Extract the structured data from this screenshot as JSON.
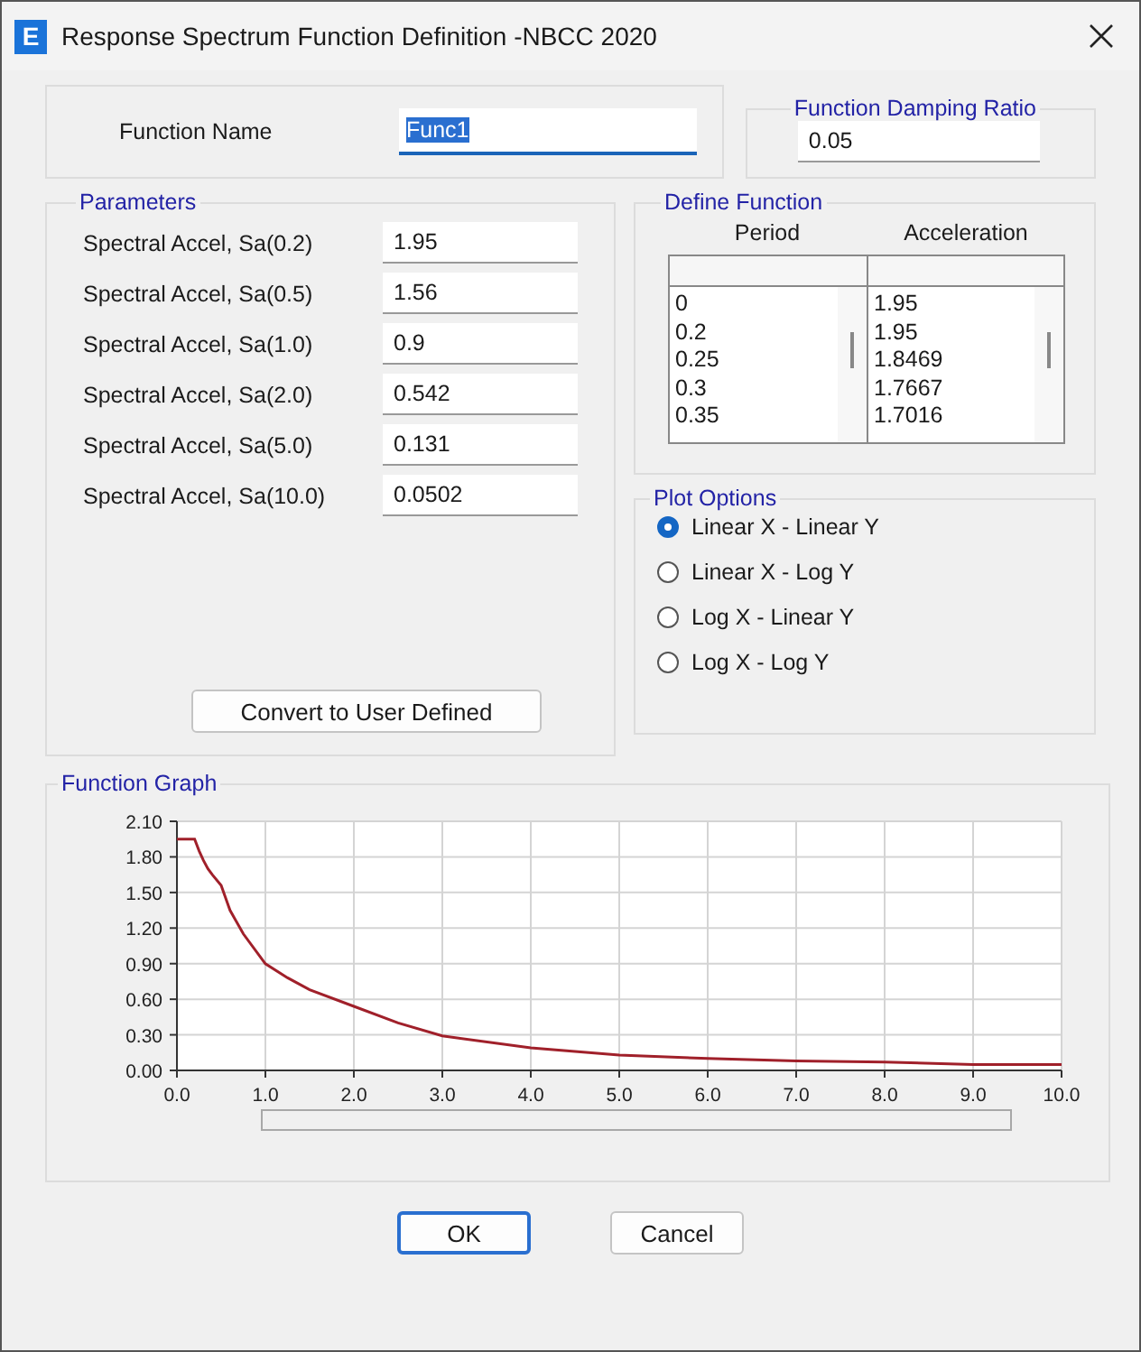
{
  "window": {
    "logo_letter": "E",
    "title": "Response Spectrum Function Definition -NBCC 2020"
  },
  "function_name": {
    "label": "Function Name",
    "value": "Func1",
    "text_selected": true
  },
  "damping": {
    "title": "Function Damping Ratio",
    "value": "0.05"
  },
  "parameters": {
    "title": "Parameters",
    "rows": [
      {
        "label": "Spectral Accel, Sa(0.2)",
        "value": "1.95"
      },
      {
        "label": "Spectral Accel, Sa(0.5)",
        "value": "1.56"
      },
      {
        "label": "Spectral Accel, Sa(1.0)",
        "value": "0.9"
      },
      {
        "label": "Spectral Accel, Sa(2.0)",
        "value": "0.542"
      },
      {
        "label": "Spectral Accel, Sa(5.0)",
        "value": "0.131"
      },
      {
        "label": "Spectral Accel, Sa(10.0)",
        "value": "0.0502"
      }
    ],
    "button": "Convert to User Defined"
  },
  "define_function": {
    "title": "Define Function",
    "columns": [
      "Period",
      "Acceleration"
    ],
    "period": [
      "0",
      "0.2",
      "0.25",
      "0.3",
      "0.35"
    ],
    "acceleration": [
      "1.95",
      "1.95",
      "1.8469",
      "1.7667",
      "1.7016"
    ]
  },
  "plot_options": {
    "title": "Plot Options",
    "options": [
      {
        "label": "Linear X - Linear Y",
        "selected": true
      },
      {
        "label": "Linear X - Log Y",
        "selected": false
      },
      {
        "label": "Log X - Linear Y",
        "selected": false
      },
      {
        "label": "Log X - Log Y",
        "selected": false
      }
    ]
  },
  "graph": {
    "title": "Function Graph",
    "chart_data": {
      "type": "line",
      "x": [
        0,
        0.2,
        0.25,
        0.3,
        0.35,
        0.4,
        0.5,
        0.6,
        0.75,
        1.0,
        1.25,
        1.5,
        2.0,
        2.5,
        3.0,
        4.0,
        5.0,
        6.0,
        7.0,
        8.0,
        9.0,
        10.0
      ],
      "series": [
        {
          "color": "#a0202a",
          "values": [
            1.95,
            1.95,
            1.85,
            1.77,
            1.7,
            1.65,
            1.56,
            1.35,
            1.15,
            0.9,
            0.78,
            0.68,
            0.54,
            0.4,
            0.29,
            0.19,
            0.13,
            0.1,
            0.08,
            0.07,
            0.05,
            0.05
          ]
        }
      ],
      "grid": true,
      "xlim": [
        0,
        10
      ],
      "ylim": [
        0,
        2.1
      ],
      "xticks": [
        {
          "value": 0,
          "label": "0.0"
        },
        {
          "value": 1,
          "label": "1.0"
        },
        {
          "value": 2,
          "label": "2.0"
        },
        {
          "value": 3,
          "label": "3.0"
        },
        {
          "value": 4,
          "label": "4.0"
        },
        {
          "value": 5,
          "label": "5.0"
        },
        {
          "value": 6,
          "label": "6.0"
        },
        {
          "value": 7,
          "label": "7.0"
        },
        {
          "value": 8,
          "label": "8.0"
        },
        {
          "value": 9,
          "label": "9.0"
        },
        {
          "value": 10,
          "label": "10.0"
        }
      ],
      "yticks": [
        {
          "value": 0,
          "label": "0.00"
        },
        {
          "value": 0.3,
          "label": "0.30"
        },
        {
          "value": 0.6,
          "label": "0.60"
        },
        {
          "value": 0.9,
          "label": "0.90"
        },
        {
          "value": 1.2,
          "label": "1.20"
        },
        {
          "value": 1.5,
          "label": "1.50"
        },
        {
          "value": 1.8,
          "label": "1.80"
        },
        {
          "value": 2.1,
          "label": "2.10"
        }
      ]
    }
  },
  "buttons": [
    {
      "label": "OK",
      "default": true
    },
    {
      "label": "Cancel",
      "default": false
    }
  ]
}
